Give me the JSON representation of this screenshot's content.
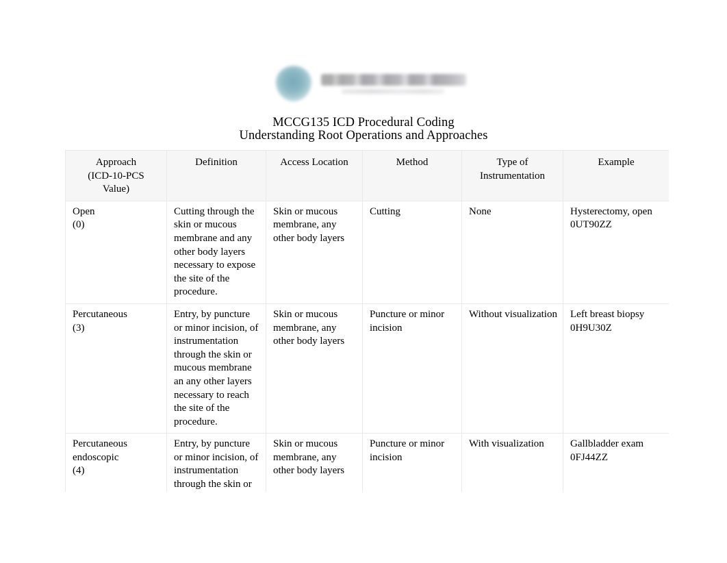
{
  "document": {
    "title_lines": [
      "MCCG135 ICD Procedural Coding",
      "Understanding Root Operations and Approaches"
    ],
    "logo": {
      "mark_color": "#7aa8b5",
      "wordmark_color": "#8e8e90",
      "legible": false
    }
  },
  "table": {
    "headers": [
      "Approach\n(ICD-10-PCS\nValue)",
      "Definition",
      "Access Location",
      "Method",
      "Type of\nInstrumentation",
      "Example"
    ],
    "header_lines": [
      [
        "Approach",
        "(ICD-10-PCS",
        "Value)"
      ],
      [
        "Definition"
      ],
      [
        "Access Location"
      ],
      [
        "Method"
      ],
      [
        "Type of",
        "Instrumentation"
      ],
      [
        "Example"
      ]
    ],
    "rows": [
      {
        "approach": "Open\n(0)",
        "approach_lines": [
          "Open",
          "(0)"
        ],
        "definition": "Cutting through the skin or mucous membrane and any other body layers necessary to expose the site of the procedure.",
        "access_location": "Skin or mucous membrane, any other body layers",
        "method": "Cutting",
        "instrumentation": "None",
        "example": "Hysterectomy, open 0UT90ZZ"
      },
      {
        "approach": "Percutaneous\n(3)",
        "approach_lines": [
          "Percutaneous",
          "(3)"
        ],
        "definition": "Entry, by puncture or minor incision, of instrumentation through the skin or mucous membrane an any other layers necessary to reach the site of the procedure.",
        "access_location": "Skin or mucous membrane, any other body layers",
        "method": "Puncture or minor incision",
        "instrumentation": "Without visualization",
        "example": "Left breast biopsy 0H9U30Z"
      },
      {
        "approach": "Percutaneous endoscopic\n(4)",
        "approach_lines": [
          "Percutaneous",
          "endoscopic",
          "(4)"
        ],
        "definition": "Entry, by puncture or minor incision, of instrumentation through the skin or mucous membrane and any other body layers necessary to",
        "access_location": "Skin or mucous membrane, any other body layers",
        "method": "Puncture or minor incision",
        "instrumentation": "With visualization",
        "example": "Gallbladder exam 0FJ44ZZ"
      }
    ]
  }
}
